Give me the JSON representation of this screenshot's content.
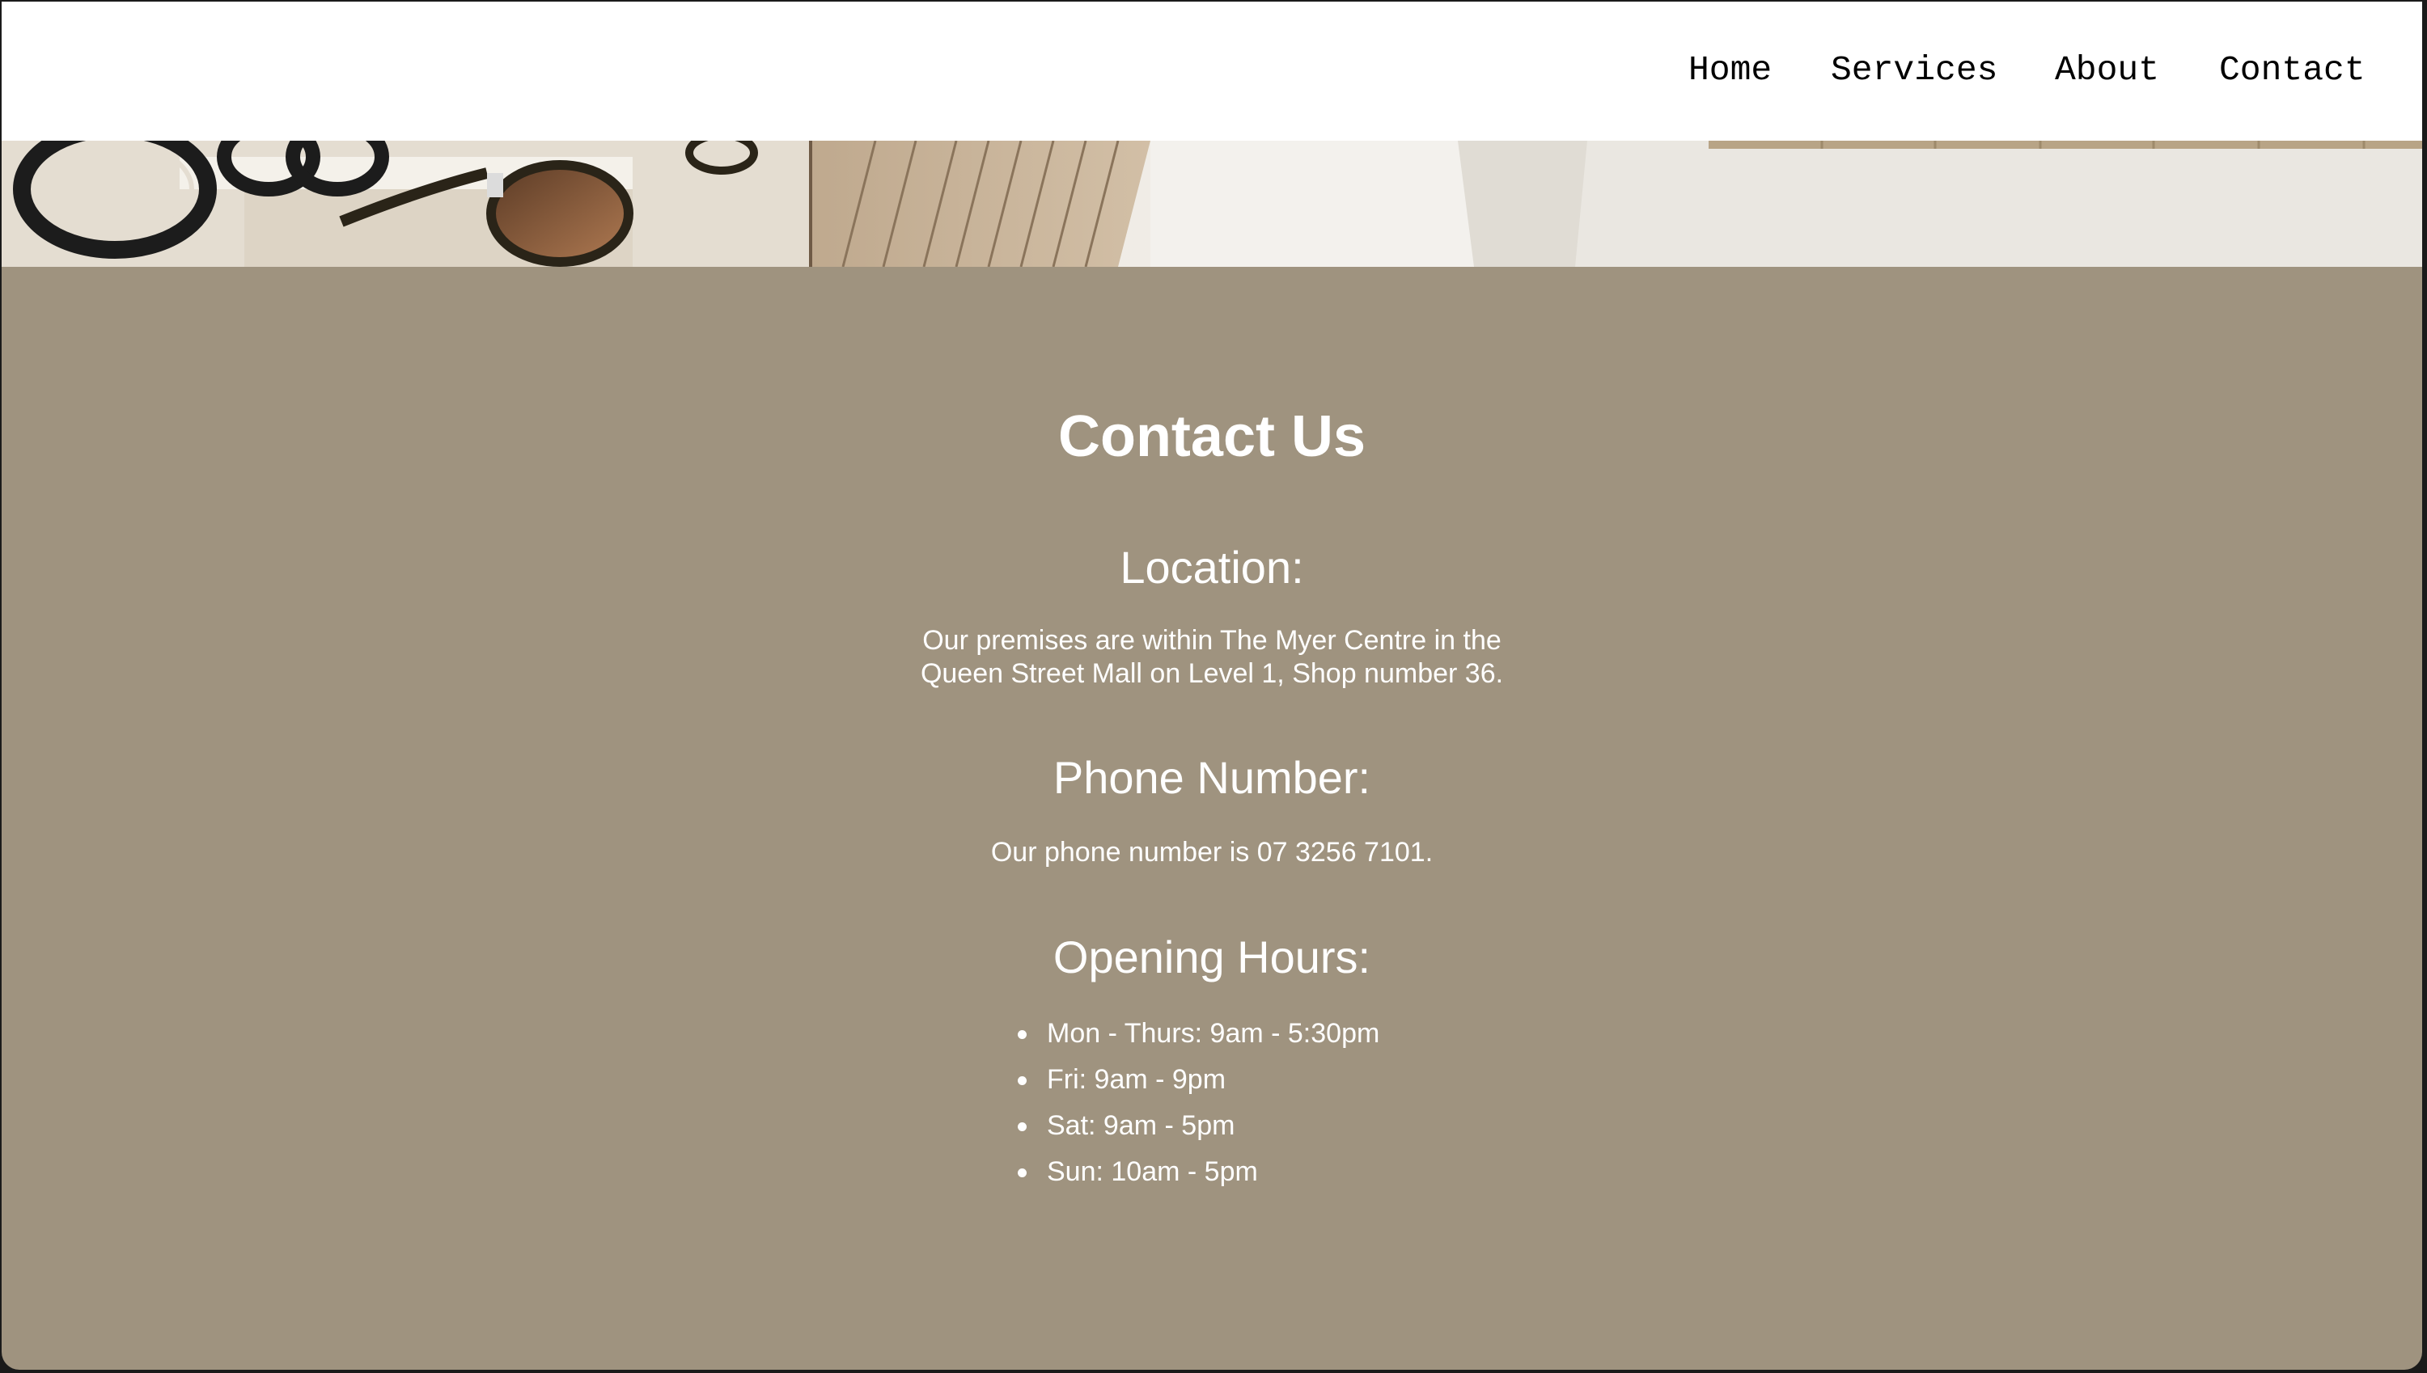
{
  "nav": {
    "items": [
      {
        "label": "Home"
      },
      {
        "label": "Services"
      },
      {
        "label": "About"
      },
      {
        "label": "Contact"
      }
    ]
  },
  "hero": {
    "description_icon": "eyewear-store-shelves-image"
  },
  "contact": {
    "title": "Contact Us",
    "location": {
      "heading": "Location:",
      "line1": "Our premises are within The Myer Centre in the",
      "line2": "Queen Street Mall on Level 1, Shop number 36."
    },
    "phone": {
      "heading": "Phone Number:",
      "text": "Our phone number is 07 3256 7101."
    },
    "hours": {
      "heading": "Opening Hours:",
      "items": [
        "Mon - Thurs: 9am - 5:30pm",
        "Fri: 9am - 9pm",
        "Sat: 9am - 5pm",
        "Sun: 10am - 5pm"
      ]
    }
  },
  "colors": {
    "background": "#9f937f",
    "navbar": "#ffffff",
    "text_on_bg": "#ffffff",
    "nav_text": "#000000"
  }
}
